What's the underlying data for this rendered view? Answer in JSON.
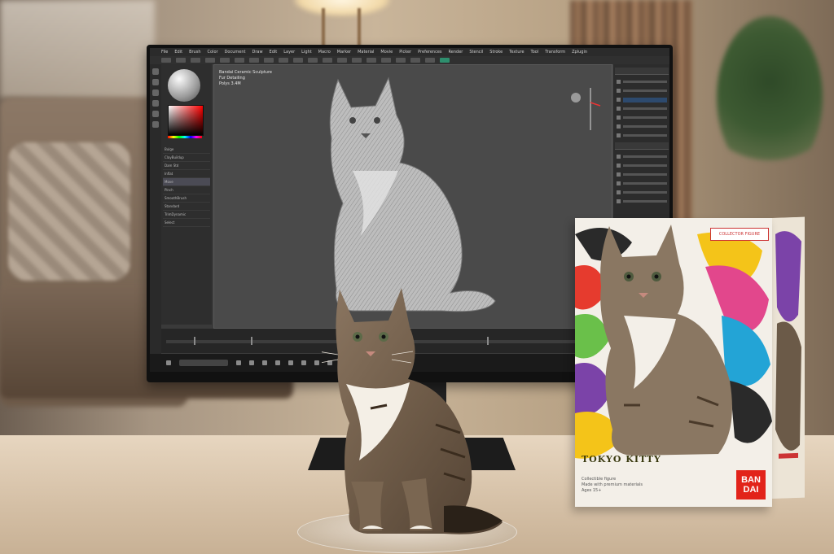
{
  "scene": {
    "description_tags": [
      "living-room",
      "desk",
      "monitor",
      "cat-figurine",
      "product-box"
    ]
  },
  "software": {
    "menu": [
      "File",
      "Edit",
      "Brush",
      "Color",
      "Document",
      "Draw",
      "Edit",
      "Layer",
      "Light",
      "Macro",
      "Marker",
      "Material",
      "Movie",
      "Picker",
      "Preferences",
      "Render",
      "Stencil",
      "Stroke",
      "Texture",
      "Tool",
      "Transform",
      "Zplugin"
    ],
    "viewport_info": [
      "Bandai Ceramic Sculpture",
      "Fur Detailing",
      "Polys 3.4M"
    ],
    "side_list": [
      "Bulge",
      "ClayBuildup",
      "Dam Std",
      "Inflat",
      "Move",
      "Pinch",
      "SmoothBrush",
      "Standard",
      "TrimDynamic",
      "Select"
    ],
    "accent_color": "#2e8f6e"
  },
  "box": {
    "label_top": "COLLECTOR FIGURE",
    "title": "TOKYO KITTY",
    "fine_print": [
      "Collectible figure",
      "Made with premium materials",
      "Ages 15+"
    ],
    "brand": [
      "BAN",
      "DAI"
    ],
    "brand_color": "#e2231a"
  }
}
